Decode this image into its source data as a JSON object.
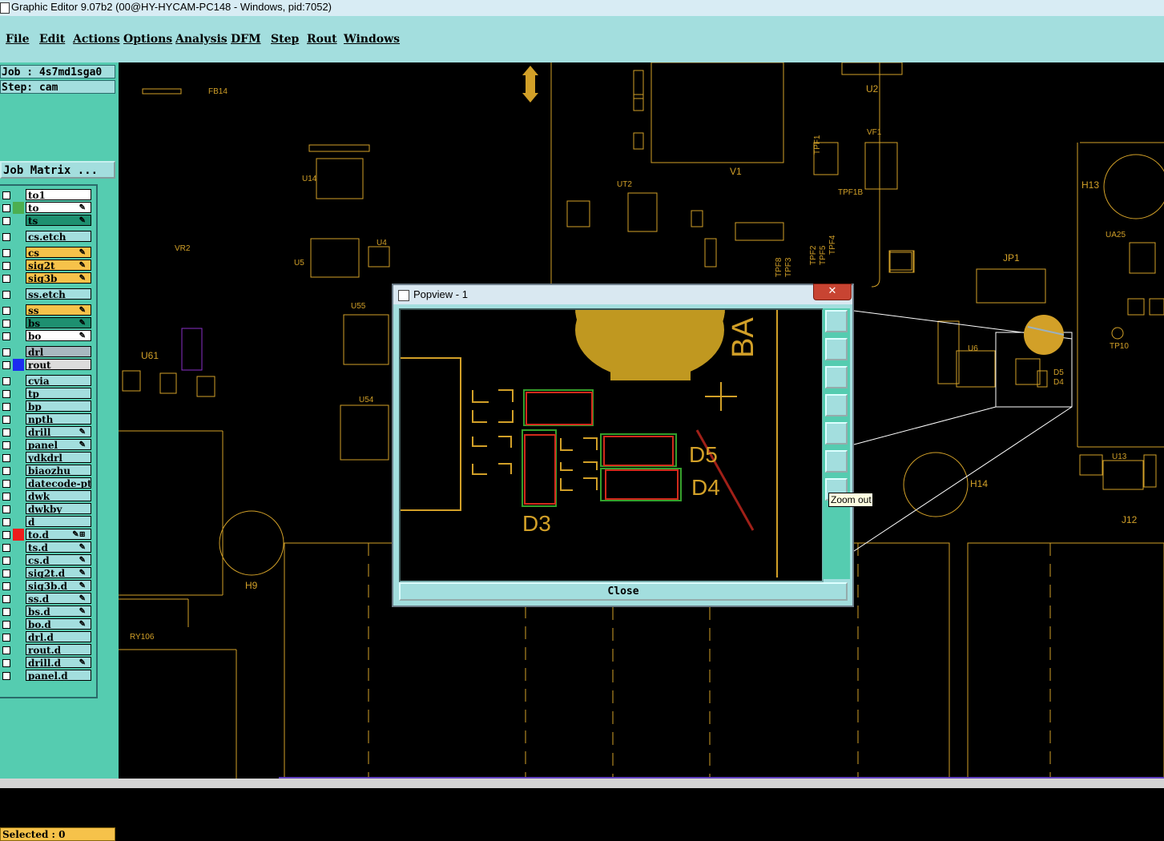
{
  "window": {
    "title": "Graphic Editor 9.07b2 (00@HY-HYCAM-PC148 - Windows, pid:7052)"
  },
  "menu": {
    "file": "File",
    "edit": "Edit",
    "actions": "Actions",
    "options": "Options",
    "analysis": "Analysis",
    "dfm": "DFM",
    "step": "Step",
    "rout": "Rout",
    "windows": "Windows"
  },
  "info": {
    "job": "Job : 4s7md1sga0",
    "step": "Step: cam",
    "job_matrix": "Job Matrix ..."
  },
  "layers": [
    {
      "name": "to1",
      "bg": "#ffffff",
      "swatch": "",
      "mark": ""
    },
    {
      "name": "to",
      "bg": "#ffffff",
      "swatch": "#4caf50",
      "mark": "✎"
    },
    {
      "name": "ts",
      "bg": "#1e9070",
      "swatch": "",
      "mark": "✎"
    },
    {
      "name": "cs.etch",
      "bg": "#a3dede",
      "swatch": "",
      "mark": ""
    },
    {
      "name": "cs",
      "bg": "#f6c24a",
      "swatch": "",
      "mark": "✎"
    },
    {
      "name": "sig2t",
      "bg": "#f6c24a",
      "swatch": "",
      "mark": "✎"
    },
    {
      "name": "sig3b",
      "bg": "#f6c24a",
      "swatch": "",
      "mark": "✎"
    },
    {
      "name": "ss.etch",
      "bg": "#a3dede",
      "swatch": "",
      "mark": ""
    },
    {
      "name": "ss",
      "bg": "#f6c24a",
      "swatch": "",
      "mark": "✎"
    },
    {
      "name": "bs",
      "bg": "#1e9070",
      "swatch": "",
      "mark": "✎"
    },
    {
      "name": "bo",
      "bg": "#ffffff",
      "swatch": "",
      "mark": "✎"
    },
    {
      "name": "drl",
      "bg": "#a8b8c0",
      "swatch": "",
      "mark": ""
    },
    {
      "name": "rout",
      "bg": "#dcdcdc",
      "swatch": "#1c2cf0",
      "mark": ""
    },
    {
      "name": "cvia",
      "bg": "#a3dede",
      "swatch": "",
      "mark": ""
    },
    {
      "name": "tp",
      "bg": "#a3dede",
      "swatch": "",
      "mark": ""
    },
    {
      "name": "bp",
      "bg": "#a3dede",
      "swatch": "",
      "mark": ""
    },
    {
      "name": "npth",
      "bg": "#a3dede",
      "swatch": "",
      "mark": ""
    },
    {
      "name": "drill",
      "bg": "#a3dede",
      "swatch": "",
      "mark": "✎"
    },
    {
      "name": "panel",
      "bg": "#a3dede",
      "swatch": "",
      "mark": "✎"
    },
    {
      "name": "ydkdrl",
      "bg": "#a3dede",
      "swatch": "",
      "mark": ""
    },
    {
      "name": "biaozhu",
      "bg": "#a3dede",
      "swatch": "",
      "mark": ""
    },
    {
      "name": "datecode-ptc",
      "bg": "#a3dede",
      "swatch": "",
      "mark": ""
    },
    {
      "name": "dwk",
      "bg": "#a3dede",
      "swatch": "",
      "mark": ""
    },
    {
      "name": "dwkby",
      "bg": "#a3dede",
      "swatch": "",
      "mark": ""
    },
    {
      "name": "d",
      "bg": "#a3dede",
      "swatch": "",
      "mark": ""
    },
    {
      "name": "to.d",
      "bg": "#a3dede",
      "swatch": "#ee1c1c",
      "mark": "✎⊞"
    },
    {
      "name": "ts.d",
      "bg": "#a3dede",
      "swatch": "",
      "mark": "✎"
    },
    {
      "name": "cs.d",
      "bg": "#a3dede",
      "swatch": "",
      "mark": "✎"
    },
    {
      "name": "sig2t.d",
      "bg": "#a3dede",
      "swatch": "",
      "mark": "✎"
    },
    {
      "name": "sig3b.d",
      "bg": "#a3dede",
      "swatch": "",
      "mark": "✎"
    },
    {
      "name": "ss.d",
      "bg": "#a3dede",
      "swatch": "",
      "mark": "✎"
    },
    {
      "name": "bs.d",
      "bg": "#a3dede",
      "swatch": "",
      "mark": "✎"
    },
    {
      "name": "bo.d",
      "bg": "#a3dede",
      "swatch": "",
      "mark": "✎"
    },
    {
      "name": "drl.d",
      "bg": "#a3dede",
      "swatch": "",
      "mark": ""
    },
    {
      "name": "rout.d",
      "bg": "#a3dede",
      "swatch": "",
      "mark": ""
    },
    {
      "name": "drill.d",
      "bg": "#a3dede",
      "swatch": "",
      "mark": "✎"
    },
    {
      "name": "panel.d",
      "bg": "#a3dede",
      "swatch": "",
      "mark": ""
    }
  ],
  "selected": "Selected : 0",
  "canvas_labels": {
    "fb14": "FB14",
    "u14": "U14",
    "u4": "U4",
    "u5": "U5",
    "vr2": "VR2",
    "u55": "U55",
    "u61": "U61",
    "u54": "U54",
    "h9": "H9",
    "ry106": "RY106",
    "v1": "V1",
    "u2": "U2",
    "ut2": "UT2",
    "vf1": "VF1",
    "h13": "H13",
    "jp1": "JP1",
    "u6": "U6",
    "d5": "D5",
    "d4": "D4",
    "tp10": "TP10",
    "ua25": "UA25",
    "h14": "H14",
    "u13": "U13",
    "j12": "J12",
    "tpf1": "TPF1",
    "tpf1b": "TPF1B",
    "tpf2": "TPF2",
    "tpf5": "TPF5",
    "tpf4": "TPF4",
    "tpf8": "TPF8",
    "tpf3": "TPF3"
  },
  "popup": {
    "title": "Popview - 1",
    "close_x": "✕",
    "close_label": "Close",
    "tooltip": "Zoom out",
    "labels": {
      "ba": "BA",
      "d5": "D5",
      "d4": "D4",
      "d3": "D3"
    }
  },
  "colors": {
    "pcb_silk": "#d2a028",
    "pad_green": "#34a02c",
    "pad_red": "#d22a1c",
    "panel": "#55ccb0",
    "panel_light": "#a3dede"
  }
}
